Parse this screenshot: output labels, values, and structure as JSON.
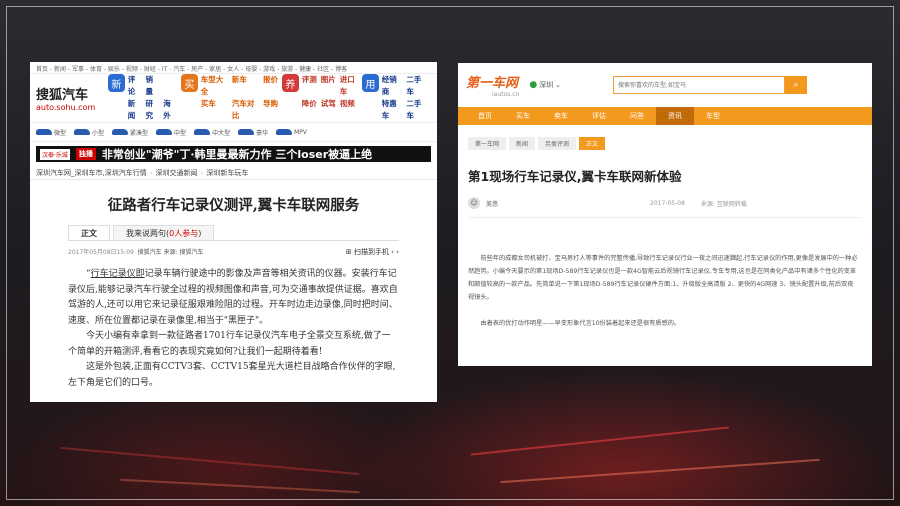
{
  "left": {
    "top_links": "首页 - 新闻 - 军事 - 体育 - 娱乐 - 视频 - 财经 - IT - 汽车 - 房产 - 家居 - 女人 - 母婴 - 游戏 - 旅游 - 健康 - 社区 - 博客",
    "logo_name": "搜狐汽车",
    "logo_domain": "auto.sohu.com",
    "nav_groups": [
      {
        "icon": "新",
        "color": "#2c6bd1",
        "style": "",
        "items": [
          "评论",
          "销量",
          "",
          "新闻",
          "研究",
          "海外"
        ]
      },
      {
        "icon": "买",
        "color": "#e6761c",
        "style": "orange",
        "items": [
          "车型大全",
          "新车",
          "报价",
          "买车",
          "汽车对比",
          "导购"
        ]
      },
      {
        "icon": "养",
        "color": "#d23b3b",
        "style": "red",
        "items": [
          "评测",
          "图片",
          "进口车",
          "降价",
          "试驾",
          "视频"
        ]
      },
      {
        "icon": "用",
        "color": "#2c6bd1",
        "style": "",
        "items": [
          "经销商",
          "二手车",
          "",
          "特惠车",
          "二手车",
          ""
        ]
      }
    ],
    "car_types": [
      "微型",
      "小型",
      "紧凑型",
      "中型",
      "中大型",
      "豪华",
      "MPV"
    ],
    "banner": {
      "tag1": "汉泰·乐城",
      "tag2": "独播",
      "text": "非常创业\"潮爷\"丁·韩里曼最新力作  三个loser被逼上绝"
    },
    "breadcrumb": [
      "深圳汽车网_深圳车市,深圳汽车行情",
      "深圳交通新闻",
      "深圳新车玩车"
    ],
    "title": "征路者行车记录仪测评,翼卡车联网服务",
    "tabs": [
      {
        "label": "正文"
      },
      {
        "label": "我来说两句",
        "count": "0人参与"
      }
    ],
    "meta_date": "2017年05月08日15:09",
    "meta_source": "搜狐汽车  来源: 搜狐汽车",
    "meta_tools": "⊞  扫描到手机  ‹  ›",
    "body": [
      {
        "lead": "“",
        "underline": "行车记录仪即",
        "text": "记录车辆行驶途中的影像及声音等相关资讯的仪器。安装行车记录仪后,能够记录汽车行驶全过程的视频图像和声音,可为交通事故提供证据。喜欢自驾游的人,还可以用它来记录征服艰难险阻的过程。开车时边走边录像,同时把时间、速度、所在位置都记录在录像里,相当于\"黑匣子\"。"
      },
      {
        "lead": "",
        "underline": "",
        "text": "今天小编有幸拿到一款征路者1701行车记录仪汽车电子全景交互系统,做了一个简单的开箱测评,看看它的表现究竟如何?让我们一起期待着看!"
      },
      {
        "lead": "",
        "underline": "",
        "text": "这是外包装,正面有CCTV3套、CCTV15套星光大道栏目战略合作伙伴的字眼,左下角是它们的口号。"
      }
    ]
  },
  "right": {
    "logo_name": "第一车网",
    "logo_domain": "iautos.cn",
    "location": "深圳",
    "search_placeholder": "搜索你喜欢的车型,如宝马",
    "search_icon": "search-icon",
    "nav": [
      "首页",
      "买车",
      "卖车",
      "评估",
      "问答",
      "资讯",
      "车型"
    ],
    "nav_active": 5,
    "breadcrumb": [
      "第一车网",
      "新闻",
      "另类评测",
      "正文"
    ],
    "title": "第1现场行车记录仪,翼卡车联网新体验",
    "author": "美悠",
    "date": "2017-05-08",
    "source": "来源: 互联网转载",
    "body": [
      "前些年的成都女司机被打、宝马男打人等事件的完整传播,导致行车记录仪行业一夜之间迅速蹿起,行车记录仪的作用,更像是发展中的一种必然趋势。小编今天要示的第1现场D-589行车记录仪也是一款4G智能云后视镜行车记录仪,专车专用,这也是在同类化产品中有诸多个性化的变革和颇值较高的一款产品。先简单说一下第1现场D-589行车记录仪硬件方面:1、升级版全高清版 2、更快的4G网速 3、镜头配置升级,前后双夜视镜头。",
      "由着表的优打动作明星——早变形象代言10份装着起来还是很有质感的。"
    ]
  }
}
